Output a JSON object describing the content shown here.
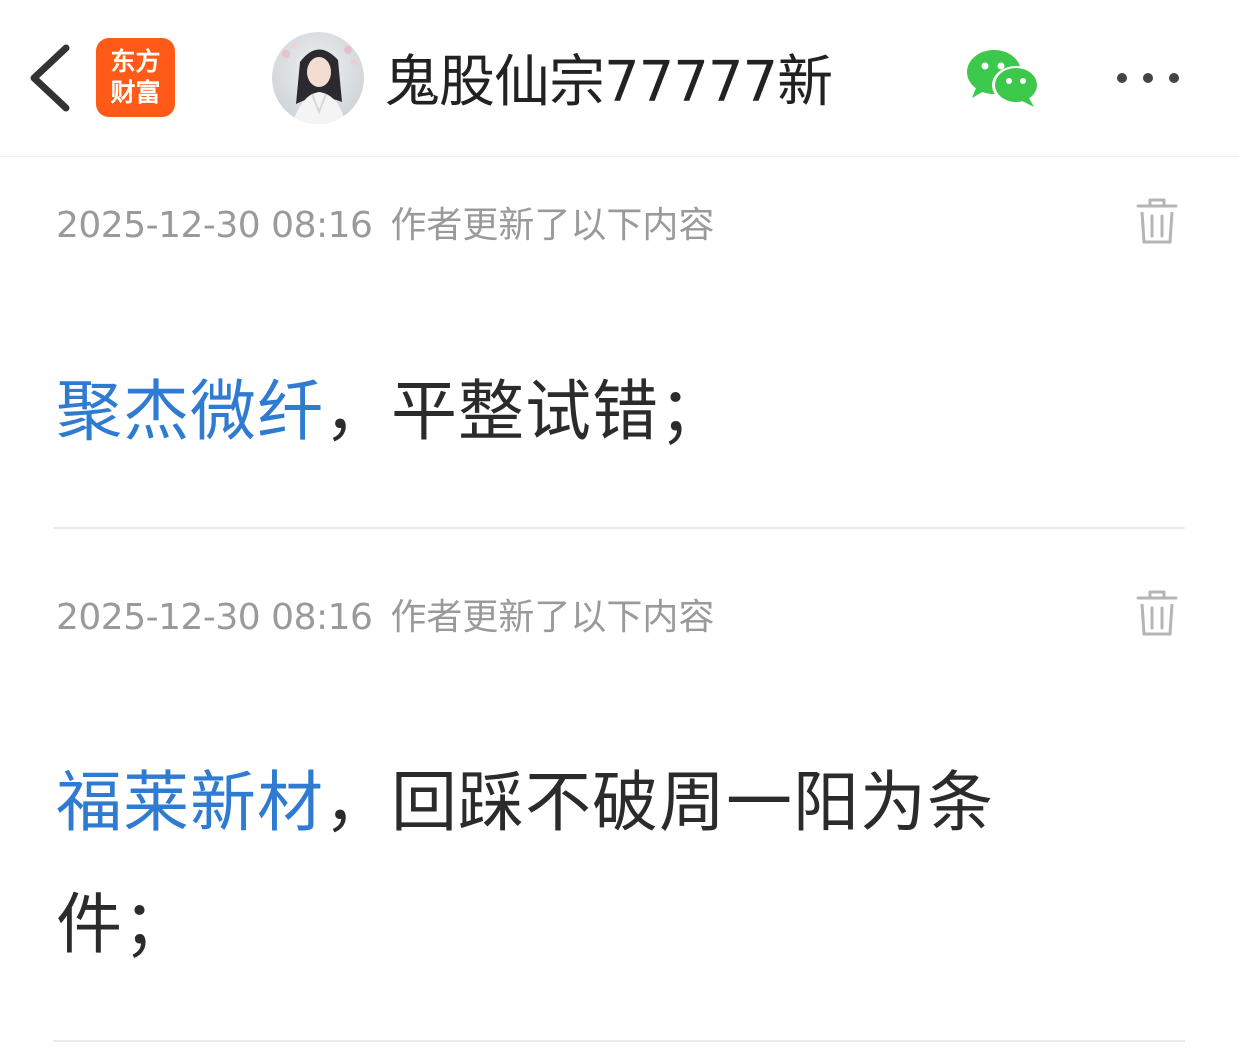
{
  "header": {
    "back_icon": "chevron-left-icon",
    "logo_line1": "东方",
    "logo_line2": "财富",
    "logo_color": "#ff5a17",
    "author_name": "鬼股仙宗77777新",
    "share_icon": "wechat-icon",
    "more_icon": "more-dots-icon"
  },
  "entries": [
    {
      "timestamp": "2025-12-30 08:16",
      "note": "作者更新了以下内容",
      "stock": "聚杰微纤",
      "text": "，平整试错；"
    },
    {
      "timestamp": "2025-12-30 08:16",
      "note": "作者更新了以下内容",
      "stock": "福莱新材",
      "text": "，回踩不破周一阳为条件；"
    }
  ],
  "colors": {
    "link": "#2f7bd2",
    "meta_text": "#9a9a9a",
    "body_text": "#2b2b2b",
    "wechat_green": "#3cc84a"
  }
}
